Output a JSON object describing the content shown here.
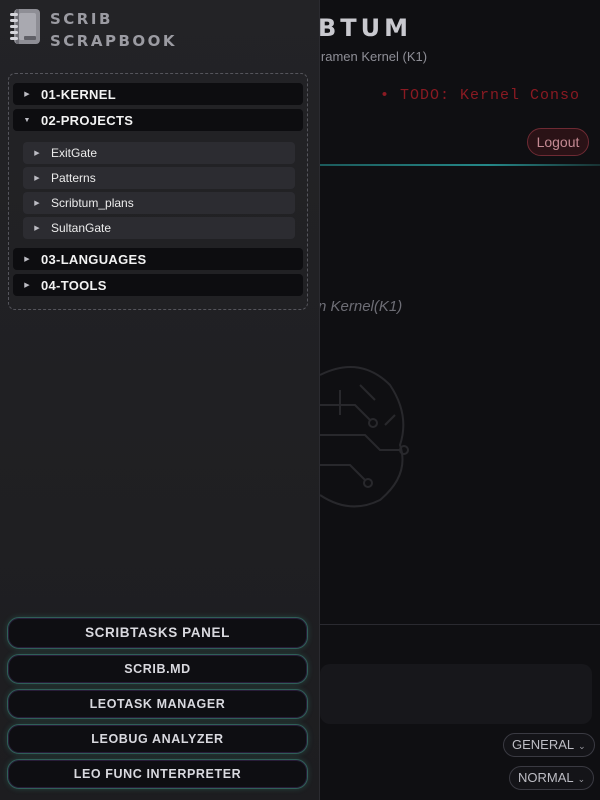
{
  "app": {
    "title_partial": "BTUM",
    "subtitle_partial": "lramen Kernel (K1)",
    "todo_partial": "• TODO: Kernel Conso",
    "logout_label": "Logout",
    "kernel_caption_partial": "n Kernel(K1)",
    "selects": {
      "mode": "GENERAL",
      "speed": "NORMAL"
    }
  },
  "brand": {
    "line1": "SCRIB",
    "line2": "SCRAPBOOK",
    "icon": "notebook-icon"
  },
  "tree": {
    "folders": [
      {
        "label": "01-KERNEL",
        "expanded": false
      },
      {
        "label": "02-PROJECTS",
        "expanded": true,
        "children": [
          "ExitGate",
          "Patterns",
          "Scribtum_plans",
          "SultanGate"
        ]
      },
      {
        "label": "03-LANGUAGES",
        "expanded": false
      },
      {
        "label": "04-TOOLS",
        "expanded": false
      }
    ]
  },
  "actions": [
    "SCRIBTASKS PANEL",
    "SCRIB.MD",
    "LEOTASK MANAGER",
    "LEOBUG ANALYZER",
    "LEO FUNC INTERPRETER"
  ],
  "colors": {
    "drawer_bg": "#232326",
    "accent_teal": "#2aa6a6",
    "button_border": "#2f5f58",
    "todo_red": "#8a1a22"
  }
}
